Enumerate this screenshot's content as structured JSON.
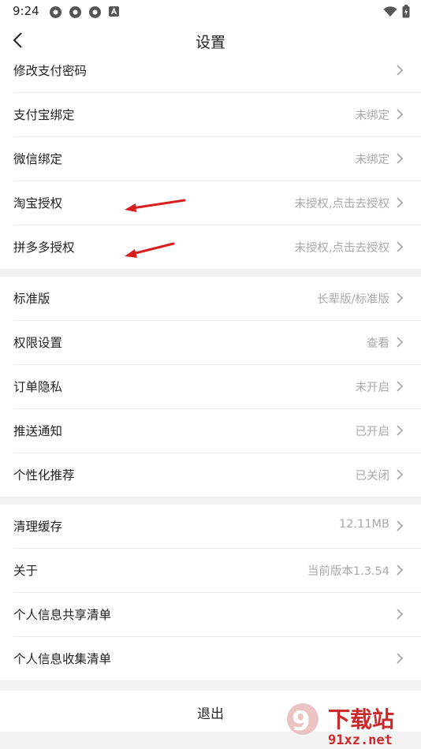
{
  "status_bar": {
    "time": "9:24"
  },
  "header": {
    "title": "设置"
  },
  "sections": [
    {
      "rows": [
        {
          "label": "修改支付密码",
          "value": ""
        },
        {
          "label": "支付宝绑定",
          "value": "未绑定"
        },
        {
          "label": "微信绑定",
          "value": "未绑定"
        },
        {
          "label": "淘宝授权",
          "value": "未授权,点击去授权"
        },
        {
          "label": "拼多多授权",
          "value": "未授权,点击去授权"
        }
      ]
    },
    {
      "rows": [
        {
          "label": "标准版",
          "value": "长辈版/标准版"
        },
        {
          "label": "权限设置",
          "value": "查看"
        },
        {
          "label": "订单隐私",
          "value": "未开启"
        },
        {
          "label": "推送通知",
          "value": "已开启"
        },
        {
          "label": "个性化推荐",
          "value": "已关闭"
        }
      ]
    },
    {
      "rows": [
        {
          "label": "清理缓存",
          "value": "12.11MB"
        },
        {
          "label": "关于",
          "value": "当前版本1.3.54"
        },
        {
          "label": "个人信息共享清单",
          "value": ""
        },
        {
          "label": "个人信息收集清单",
          "value": ""
        }
      ]
    }
  ],
  "logout": {
    "label": "退出"
  },
  "watermark": {
    "brand": "下载站",
    "domain": "91xz.net"
  },
  "colors": {
    "annotation_arrow": "#d81e1e",
    "value_text": "#a8a8a8",
    "section_gap": "#f2f2f2"
  }
}
